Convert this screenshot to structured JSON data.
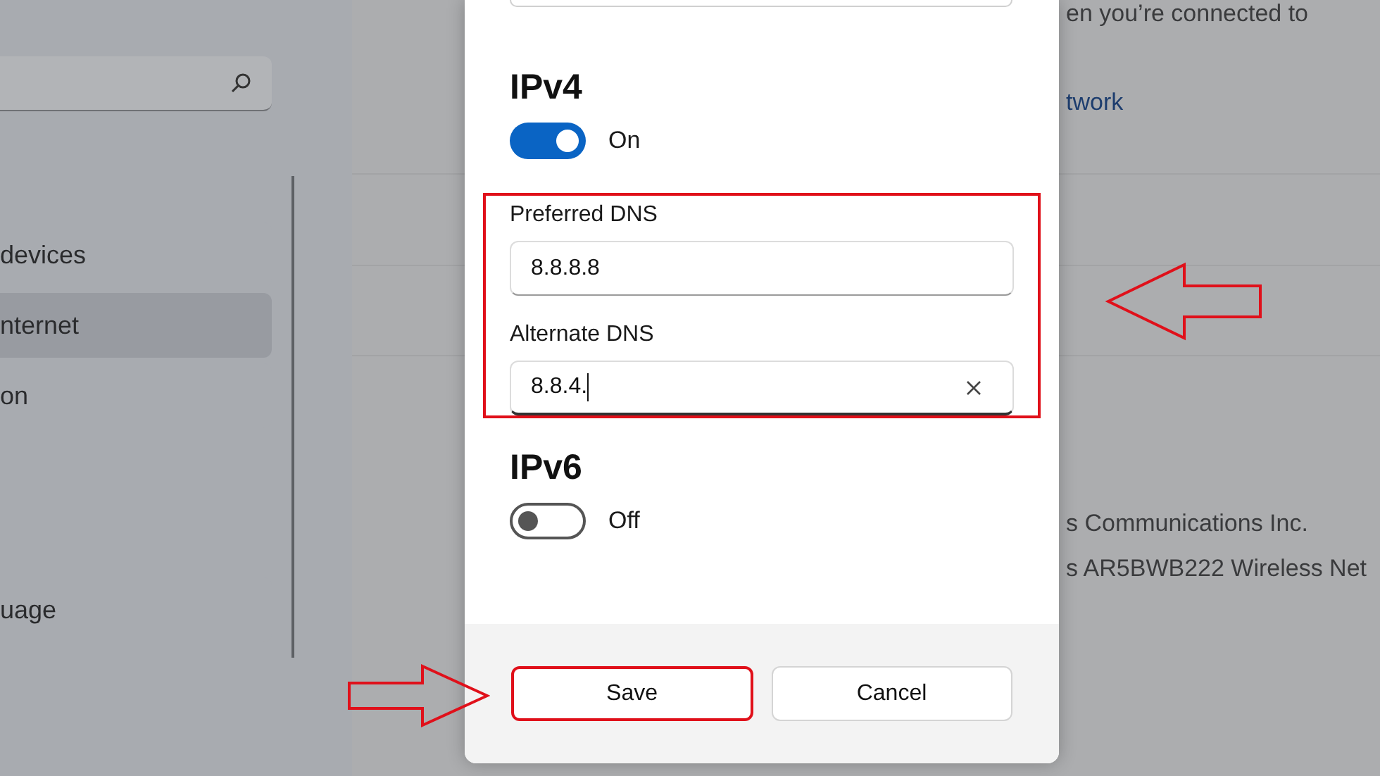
{
  "sidebar": {
    "items": [
      {
        "label": "devices",
        "selected": false
      },
      {
        "label": "nternet",
        "selected": true
      },
      {
        "label": "on",
        "selected": false
      },
      {
        "label": "uage",
        "selected": false
      }
    ]
  },
  "content": {
    "rows": [
      {
        "text": "en you’re connected to",
        "link": false
      },
      {
        "text": "twork",
        "link": true
      },
      {
        "text": "s Communications Inc.",
        "link": false
      },
      {
        "text": "s AR5BWB222 Wireless Net",
        "link": false
      }
    ]
  },
  "dialog": {
    "sections": [
      {
        "title": "IPv4",
        "toggle": {
          "on": true,
          "label": "On"
        },
        "dns_group": {
          "highlighted": true,
          "fields": [
            {
              "label": "Preferred DNS",
              "value": "8.8.8.8",
              "focused": false
            },
            {
              "label": "Alternate DNS",
              "value": "8.8.4.",
              "focused": true
            }
          ]
        }
      },
      {
        "title": "IPv6",
        "toggle": {
          "on": false,
          "label": "Off"
        }
      }
    ],
    "buttons": [
      {
        "label": "Save",
        "highlighted": true
      },
      {
        "label": "Cancel",
        "highlighted": false
      }
    ]
  }
}
